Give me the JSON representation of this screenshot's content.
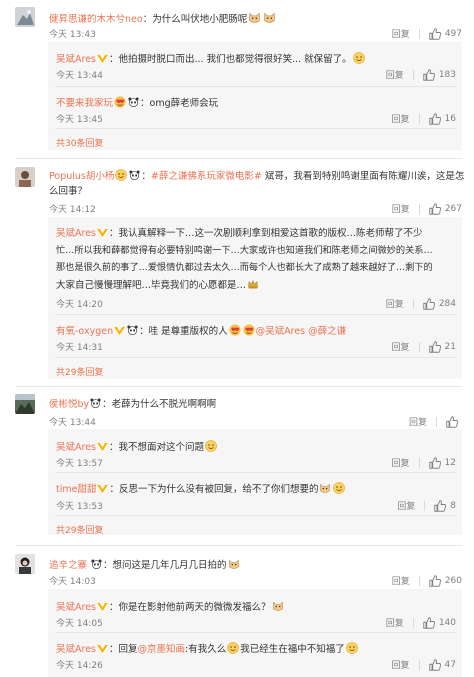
{
  "comments": [
    {
      "id": "c1",
      "user": "健昇思谦的木木兮neo",
      "text": "：为什么叫伏地小肥肠呢",
      "time": "今天 13:43",
      "reply": "回复",
      "likes": "497",
      "replies": [
        {
          "user": "吴斌Ares",
          "text": "：他拍摄时脱口而出... 我们也都觉得很好笑... 就保留了。",
          "time": "今天 13:44",
          "reply": "回复",
          "likes": "183"
        },
        {
          "user": "不要来我家玩",
          "text": "：omg薛老师会玩",
          "time": "今天 13:45",
          "reply": "回复",
          "likes": "16"
        }
      ],
      "more": "共30条回复"
    },
    {
      "id": "c2",
      "user": "Populus胡小杨",
      "text_tag": "#薛之谦佛系玩家微电影#",
      "text": " 斌哥，我看到特别鸣谢里面有陈耀川诶，这是怎么回事？",
      "text_line2": "么回事？",
      "time": "今天 14:12",
      "reply": "回复",
      "likes": "267",
      "replies": [
        {
          "user": "吴斌Ares",
          "lines": [
            "：我认真解释一下…这一次剧顺利拿到相爱这首歌的版权…陈老师帮了不少",
            "忙…所以我和薛都觉得有必要特别鸣谢一下…大家或许也知道我们和陈老师之间微妙的关系…",
            "那也是很久前的事了…爱恨情仇都过去太久…而每个人也都长大了成熟了越来越好了…剩下的",
            "大家自己慢慢理解吧…毕竟我们的心愿都是…"
          ],
          "time": "今天 14:20",
          "reply": "回复",
          "likes": "284"
        },
        {
          "user": "有氧-oxygen",
          "text_a": "：哇 是尊重版权的人",
          "mention_a": "@吴斌Ares",
          "mention_b": "@薛之谦",
          "time": "今天 14:31",
          "reply": "回复",
          "likes": "21"
        }
      ],
      "more": "共29条回复"
    },
    {
      "id": "c3",
      "user": "侯彬悦by",
      "text": "：老薛为什么不脱光啊啊啊",
      "time": "今天 13:44",
      "reply": "回复",
      "likes": "",
      "replies": [
        {
          "user": "吴斌Ares",
          "text": "：我不想面对这个问题",
          "time": "今天 13:57",
          "reply": "回复",
          "likes": "12"
        },
        {
          "user": "time甜甜",
          "text": "：反思一下为什么没有被回复，给不了你们想要的",
          "time": "今天 13:53",
          "reply": "回复",
          "likes": "8"
        }
      ],
      "more": "共29条回复"
    },
    {
      "id": "c4",
      "user": "追辛之寨",
      "text": "：想问这是几年几月几日拍的",
      "time": "今天 14:03",
      "reply": "回复",
      "likes": "260",
      "replies": [
        {
          "user": "吴斌Ares",
          "text": "：你是在影射他前两天的微微发福么？",
          "time": "今天 14:05",
          "reply": "回复",
          "likes": "140"
        },
        {
          "user": "吴斌Ares",
          "text_pre": "：回复",
          "mention": "@京墨知画",
          "text": ":有我久么",
          "text_post": "我已经生在福中不知福了",
          "time": "今天 14:26",
          "reply": "回复",
          "likes": "47"
        }
      ]
    }
  ],
  "colors": {
    "name": "#eb7350",
    "text": "#333333",
    "meta": "#808080",
    "subbox": "#f6f6f6"
  },
  "icons": [
    "thumb-up-icon",
    "vip-badge-icon",
    "emoji-icon",
    "panda-emoji-icon",
    "crown-emoji-icon"
  ]
}
